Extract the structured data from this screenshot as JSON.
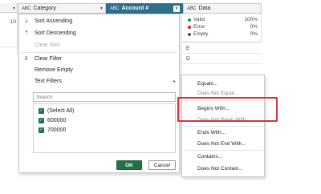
{
  "left_column": {
    "cell_value": "10"
  },
  "columns": {
    "category": {
      "type_icon": "ABC",
      "label": "Category"
    },
    "account": {
      "type_icon": "ABC",
      "label": "Account #"
    },
    "data": {
      "type_icon": "ABC",
      "label": "Data"
    }
  },
  "column_quality": {
    "valid_label": "Valid",
    "valid_pct": "100%",
    "valid_color": "#2e8b57",
    "error_label": "Error",
    "error_pct": "0%",
    "error_color": "#c62828",
    "empty_label": "Empty",
    "empty_pct": "0%",
    "empty_color": "#555555"
  },
  "data_cells": [
    "E",
    "D"
  ],
  "menu": {
    "sort_asc": "Sort Ascending",
    "sort_desc": "Sort Descending",
    "clear_sort": "Clear Sort",
    "clear_filter": "Clear Filter",
    "remove_empty": "Remove Empty",
    "text_filters": "Text Filters",
    "search_placeholder": "Search",
    "select_all": "(Select All)",
    "value_1": "600000",
    "value_2": "700000",
    "ok_label": "OK",
    "cancel_label": "Cancel"
  },
  "submenu": {
    "equals": "Equals...",
    "does_not_equal": "Does Not Equal...",
    "begins_with": "Begins With...",
    "does_not_begin_with": "Does Not Begin With...",
    "ends_with": "Ends With...",
    "does_not_end_with": "Does Not End With...",
    "contains": "Contains...",
    "does_not_contain": "Does Not Contain..."
  },
  "colors": {
    "accent_green": "#217346",
    "header_blue": "#2f6f8c",
    "highlight_red": "#d9333a"
  }
}
